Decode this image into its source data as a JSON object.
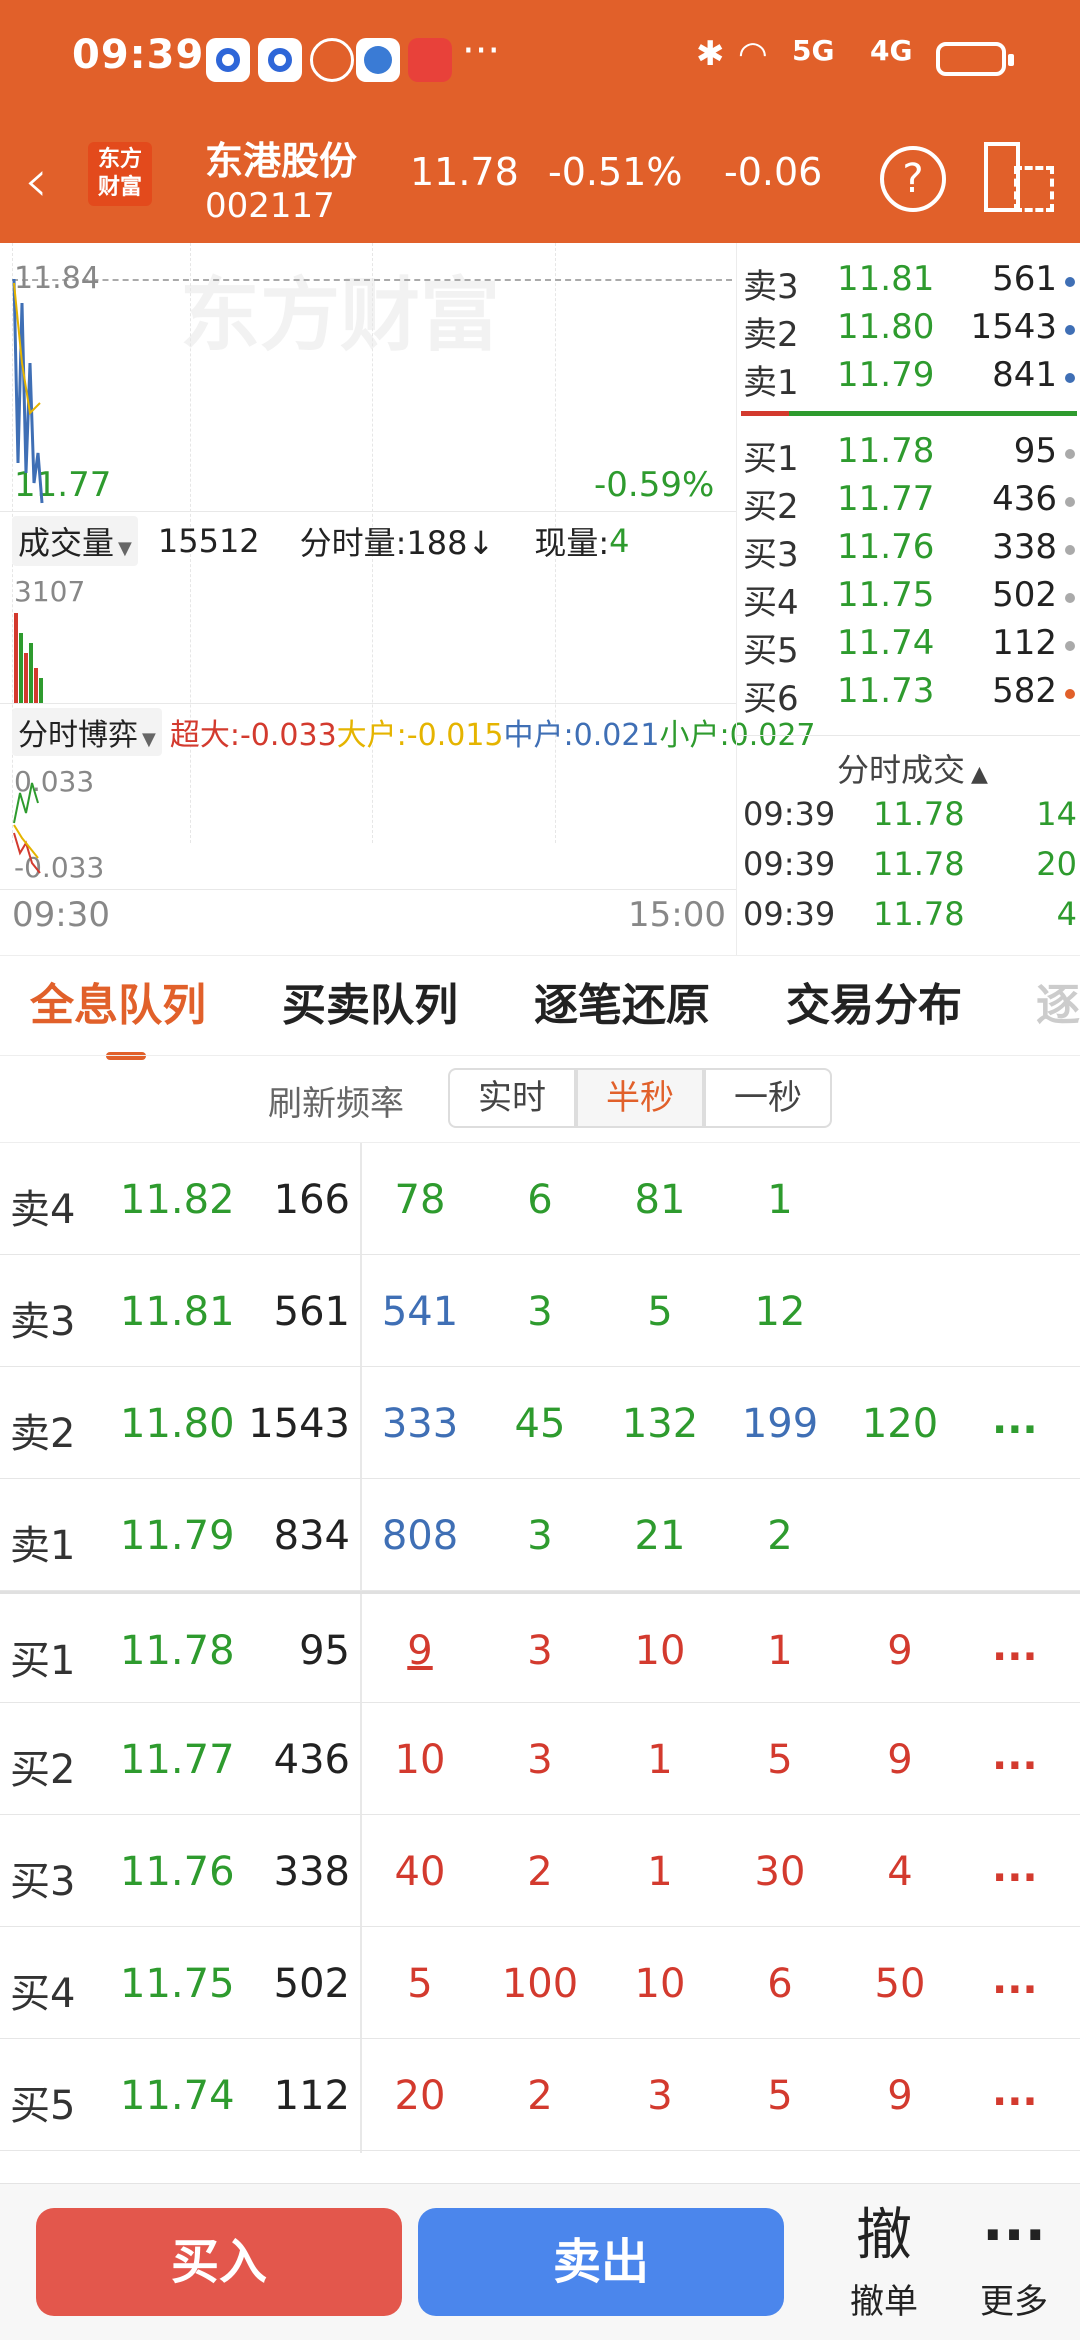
{
  "status_bar": {
    "time": "09:39",
    "dots": "···",
    "net1": "5G",
    "net2": "4G"
  },
  "header": {
    "logo_line1": "东方",
    "logo_line2": "财富",
    "stock_name": "东港股份",
    "stock_code": "002117",
    "price": "11.78",
    "change_pct": "-0.51%",
    "change": "-0.06",
    "help_glyph": "?"
  },
  "chart": {
    "watermark": "东方财富",
    "high_label": "11.84",
    "low_label": "11.77",
    "pct_label": "-0.59%",
    "volume_selector": "成交量",
    "volume_total": "15512",
    "minute_volume_label": "分时量:188↓",
    "current_volume_label": "现量:",
    "current_volume": "4",
    "volume_max": "3107",
    "game_selector": "分时博弈",
    "super_label": "超大:-0.033",
    "large_label": "大户:-0.015",
    "mid_label": "中户:0.021",
    "small_label": "小户:0.027",
    "game_top": "0.033",
    "game_bottom": "-0.033",
    "time_start": "09:30",
    "time_end": "15:00"
  },
  "order_book": {
    "sells": [
      {
        "label": "卖3",
        "price": "11.81",
        "volume": "561"
      },
      {
        "label": "卖2",
        "price": "11.80",
        "volume": "1543"
      },
      {
        "label": "卖1",
        "price": "11.79",
        "volume": "841"
      }
    ],
    "buys": [
      {
        "label": "买1",
        "price": "11.78",
        "volume": "95"
      },
      {
        "label": "买2",
        "price": "11.77",
        "volume": "436"
      },
      {
        "label": "买3",
        "price": "11.76",
        "volume": "338"
      },
      {
        "label": "买4",
        "price": "11.75",
        "volume": "502"
      },
      {
        "label": "买5",
        "price": "11.74",
        "volume": "112"
      },
      {
        "label": "买6",
        "price": "11.73",
        "volume": "582"
      }
    ],
    "ticks_title": "分时成交",
    "ticks": [
      {
        "time": "09:39",
        "price": "11.78",
        "volume": "14"
      },
      {
        "time": "09:39",
        "price": "11.78",
        "volume": "20"
      },
      {
        "time": "09:39",
        "price": "11.78",
        "volume": "4"
      }
    ]
  },
  "tabs": [
    "全息队列",
    "买卖队列",
    "逐笔还原",
    "交易分布",
    "逐"
  ],
  "refresh": {
    "label": "刷新频率",
    "options": [
      "实时",
      "半秒",
      "一秒"
    ],
    "selected": "半秒"
  },
  "queue": {
    "rows": [
      {
        "label": "卖4",
        "price": "11.82",
        "volume": "166",
        "orders": [
          "78",
          "6",
          "81",
          "1"
        ],
        "more": ""
      },
      {
        "label": "卖3",
        "price": "11.81",
        "volume": "561",
        "orders": [
          "541",
          "3",
          "5",
          "12"
        ],
        "more": ""
      },
      {
        "label": "卖2",
        "price": "11.80",
        "volume": "1543",
        "orders": [
          "333",
          "45",
          "132",
          "199",
          "120"
        ],
        "more": "..."
      },
      {
        "label": "卖1",
        "price": "11.79",
        "volume": "834",
        "orders": [
          "808",
          "3",
          "21",
          "2"
        ],
        "more": ""
      },
      {
        "label": "买1",
        "price": "11.78",
        "volume": "95",
        "orders": [
          "9",
          "3",
          "10",
          "1",
          "9"
        ],
        "more": "..."
      },
      {
        "label": "买2",
        "price": "11.77",
        "volume": "436",
        "orders": [
          "10",
          "3",
          "1",
          "5",
          "9"
        ],
        "more": "..."
      },
      {
        "label": "买3",
        "price": "11.76",
        "volume": "338",
        "orders": [
          "40",
          "2",
          "1",
          "30",
          "4"
        ],
        "more": "..."
      },
      {
        "label": "买4",
        "price": "11.75",
        "volume": "502",
        "orders": [
          "5",
          "100",
          "10",
          "6",
          "50"
        ],
        "more": "..."
      },
      {
        "label": "买5",
        "price": "11.74",
        "volume": "112",
        "orders": [
          "20",
          "2",
          "3",
          "5",
          "9"
        ],
        "more": "..."
      }
    ]
  },
  "bottom_bar": {
    "buy": "买入",
    "sell": "卖出",
    "cancel_icon": "撤",
    "cancel": "撤单",
    "more_icon": "···",
    "more": "更多"
  },
  "colors": {
    "brand": "#E1602A",
    "up_red": "#D33A2E",
    "down_green": "#2E9B2E",
    "blue": "#3F6FB5",
    "buy_btn": "#E3574C",
    "sell_btn": "#4B86EC"
  }
}
